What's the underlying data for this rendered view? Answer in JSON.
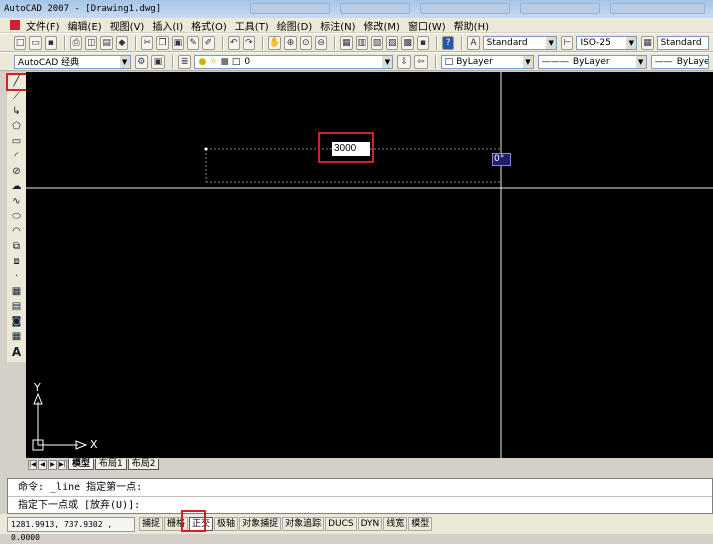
{
  "window": {
    "title": "AutoCAD 2007 - [Drawing1.dwg]"
  },
  "menu": [
    "文件(F)",
    "编辑(E)",
    "视图(V)",
    "插入(I)",
    "格式(O)",
    "工具(T)",
    "绘图(D)",
    "标注(N)",
    "修改(M)",
    "窗口(W)",
    "帮助(H)"
  ],
  "toolbar_styles": {
    "text_style": "Standard",
    "dim_style": "ISO-25",
    "table_style": "Standard"
  },
  "workspace": "AutoCAD 经典",
  "layer": {
    "current": "0"
  },
  "properties": {
    "color": "ByLayer",
    "linetype": "ByLayer",
    "lineweight": "ByLayer"
  },
  "drawing": {
    "dyn_input_value": "3000",
    "angle_tooltip": "0°",
    "ucs_y_label": "Y",
    "ucs_x_label": "X"
  },
  "layout_tabs": [
    "模型",
    "布局1",
    "布局2"
  ],
  "command_line": [
    "命令: _line 指定第一点:",
    "指定下一点或 [放弃(U)]:"
  ],
  "status": {
    "coords": "1281.9913, 737.9302 , 0.0000",
    "buttons": [
      {
        "label": "捕捉",
        "on": false
      },
      {
        "label": "栅格",
        "on": false
      },
      {
        "label": "正交",
        "on": true
      },
      {
        "label": "极轴",
        "on": false
      },
      {
        "label": "对象捕捉",
        "on": false
      },
      {
        "label": "对象追踪",
        "on": false
      },
      {
        "label": "DUCS",
        "on": false
      },
      {
        "label": "DYN",
        "on": false
      },
      {
        "label": "线宽",
        "on": false
      },
      {
        "label": "模型",
        "on": false
      }
    ]
  },
  "colors": {
    "canvas": "#000000",
    "highlight": "#d0202a",
    "tooltip_bg": "#1c1f6e"
  }
}
